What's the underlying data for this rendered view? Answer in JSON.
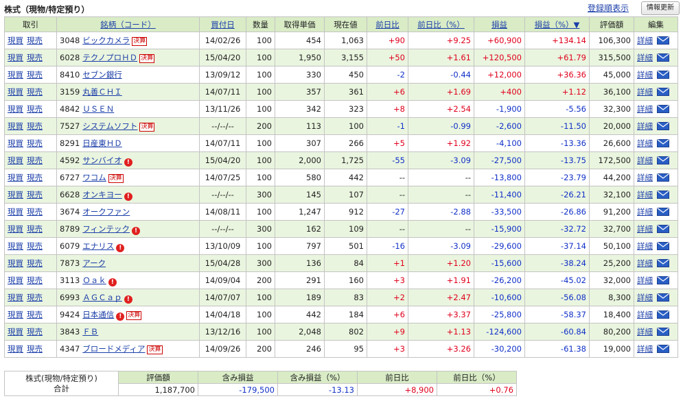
{
  "header": {
    "title": "株式（現物/特定預り）",
    "sort_link": "登録順表示",
    "refresh_button": "情報更新"
  },
  "columns": [
    "取引",
    "銘柄（コード）",
    "買付日",
    "数量",
    "取得単価",
    "現在値",
    "前日比",
    "前日比（%）",
    "損益",
    "損益（%）▼",
    "評価額",
    "編集"
  ],
  "action_labels": {
    "buy": "現買",
    "sell": "現売",
    "detail": "詳細",
    "kessan": "決算",
    "alert": "!"
  },
  "rows": [
    {
      "code": "3048",
      "name": "ビックカメラ",
      "kessan": true,
      "alert": false,
      "date": "14/02/26",
      "qty": "100",
      "cost": "454",
      "price": "1,063",
      "chg": "+90",
      "chg_pct": "+9.25",
      "pl": "+60,900",
      "pl_pct": "+134.14",
      "value": "106,300"
    },
    {
      "code": "6028",
      "name": "テクノプロＨＤ",
      "kessan": true,
      "alert": false,
      "date": "15/04/20",
      "qty": "100",
      "cost": "1,950",
      "price": "3,155",
      "chg": "+50",
      "chg_pct": "+1.61",
      "pl": "+120,500",
      "pl_pct": "+61.79",
      "value": "315,500"
    },
    {
      "code": "8410",
      "name": "セブン銀行",
      "kessan": false,
      "alert": false,
      "date": "13/09/12",
      "qty": "100",
      "cost": "330",
      "price": "450",
      "chg": "-2",
      "chg_pct": "-0.44",
      "pl": "+12,000",
      "pl_pct": "+36.36",
      "value": "45,000"
    },
    {
      "code": "3159",
      "name": "丸善ＣＨＩ",
      "kessan": false,
      "alert": false,
      "date": "14/07/11",
      "qty": "100",
      "cost": "357",
      "price": "361",
      "chg": "+6",
      "chg_pct": "+1.69",
      "pl": "+400",
      "pl_pct": "+1.12",
      "value": "36,100"
    },
    {
      "code": "4842",
      "name": "ＵＳＥＮ",
      "kessan": false,
      "alert": false,
      "date": "13/11/26",
      "qty": "100",
      "cost": "342",
      "price": "323",
      "chg": "+8",
      "chg_pct": "+2.54",
      "pl": "-1,900",
      "pl_pct": "-5.56",
      "value": "32,300"
    },
    {
      "code": "7527",
      "name": "システムソフト",
      "kessan": true,
      "alert": false,
      "date": "--/--/--",
      "qty": "200",
      "cost": "113",
      "price": "100",
      "chg": "-1",
      "chg_pct": "-0.99",
      "pl": "-2,600",
      "pl_pct": "-11.50",
      "value": "20,000"
    },
    {
      "code": "8291",
      "name": "日産東ＨＤ",
      "kessan": false,
      "alert": false,
      "date": "14/07/11",
      "qty": "100",
      "cost": "307",
      "price": "266",
      "chg": "+5",
      "chg_pct": "+1.92",
      "pl": "-4,100",
      "pl_pct": "-13.36",
      "value": "26,600"
    },
    {
      "code": "4592",
      "name": "サンバイオ",
      "kessan": false,
      "alert": true,
      "date": "15/04/20",
      "qty": "100",
      "cost": "2,000",
      "price": "1,725",
      "chg": "-55",
      "chg_pct": "-3.09",
      "pl": "-27,500",
      "pl_pct": "-13.75",
      "value": "172,500"
    },
    {
      "code": "6727",
      "name": "ワコム",
      "kessan": true,
      "alert": false,
      "date": "14/07/25",
      "qty": "100",
      "cost": "580",
      "price": "442",
      "chg": "--",
      "chg_pct": "--",
      "pl": "-13,800",
      "pl_pct": "-23.79",
      "value": "44,200"
    },
    {
      "code": "6628",
      "name": "オンキヨー",
      "kessan": false,
      "alert": true,
      "date": "--/--/--",
      "qty": "300",
      "cost": "145",
      "price": "107",
      "chg": "--",
      "chg_pct": "--",
      "pl": "-11,400",
      "pl_pct": "-26.21",
      "value": "32,100"
    },
    {
      "code": "3674",
      "name": "オークファン",
      "kessan": false,
      "alert": false,
      "date": "14/08/11",
      "qty": "100",
      "cost": "1,247",
      "price": "912",
      "chg": "-27",
      "chg_pct": "-2.88",
      "pl": "-33,500",
      "pl_pct": "-26.86",
      "value": "91,200"
    },
    {
      "code": "8789",
      "name": "フィンテック",
      "kessan": false,
      "alert": true,
      "date": "--/--/--",
      "qty": "300",
      "cost": "162",
      "price": "109",
      "chg": "--",
      "chg_pct": "--",
      "pl": "-15,900",
      "pl_pct": "-32.72",
      "value": "32,700"
    },
    {
      "code": "6079",
      "name": "エナリス",
      "kessan": false,
      "alert": true,
      "date": "13/10/09",
      "qty": "100",
      "cost": "797",
      "price": "501",
      "chg": "-16",
      "chg_pct": "-3.09",
      "pl": "-29,600",
      "pl_pct": "-37.14",
      "value": "50,100"
    },
    {
      "code": "7873",
      "name": "アーク",
      "kessan": false,
      "alert": false,
      "date": "15/04/28",
      "qty": "300",
      "cost": "136",
      "price": "84",
      "chg": "+1",
      "chg_pct": "+1.20",
      "pl": "-15,600",
      "pl_pct": "-38.24",
      "value": "25,200"
    },
    {
      "code": "3113",
      "name": "Ｏａｋ",
      "kessan": false,
      "alert": true,
      "date": "14/09/04",
      "qty": "200",
      "cost": "291",
      "price": "160",
      "chg": "+3",
      "chg_pct": "+1.91",
      "pl": "-26,200",
      "pl_pct": "-45.02",
      "value": "32,000"
    },
    {
      "code": "6993",
      "name": "ＡＧＣａｐ",
      "kessan": false,
      "alert": true,
      "date": "14/07/07",
      "qty": "100",
      "cost": "189",
      "price": "83",
      "chg": "+2",
      "chg_pct": "+2.47",
      "pl": "-10,600",
      "pl_pct": "-56.08",
      "value": "8,300"
    },
    {
      "code": "9424",
      "name": "日本通信",
      "kessan": true,
      "alert": true,
      "date": "14/04/18",
      "qty": "100",
      "cost": "442",
      "price": "184",
      "chg": "+6",
      "chg_pct": "+3.37",
      "pl": "-25,800",
      "pl_pct": "-58.37",
      "value": "18,400"
    },
    {
      "code": "3843",
      "name": "ＦＢ",
      "kessan": false,
      "alert": false,
      "date": "13/12/16",
      "qty": "100",
      "cost": "2,048",
      "price": "802",
      "chg": "+9",
      "chg_pct": "+1.13",
      "pl": "-124,600",
      "pl_pct": "-60.84",
      "value": "80,200"
    },
    {
      "code": "4347",
      "name": "ブロードメディア",
      "kessan": true,
      "alert": false,
      "date": "14/09/26",
      "qty": "200",
      "cost": "246",
      "price": "95",
      "chg": "+3",
      "chg_pct": "+3.26",
      "pl": "-30,200",
      "pl_pct": "-61.38",
      "value": "19,000"
    }
  ],
  "summary": {
    "label_line1": "株式(現物/特定預り)",
    "label_line2": "合計",
    "headers": [
      "評価額",
      "含み損益",
      "含み損益（%）",
      "前日比",
      "前日比（%）"
    ],
    "values": [
      "1,187,700",
      "-179,500",
      "-13.13",
      "+8,900",
      "+0.76"
    ]
  },
  "colors": {
    "positive": "#e0001c",
    "negative": "#1030c8",
    "header_bg": "#d9ecc6",
    "alt_row_bg": "#eaf5df",
    "link": "#1a3ea8"
  }
}
